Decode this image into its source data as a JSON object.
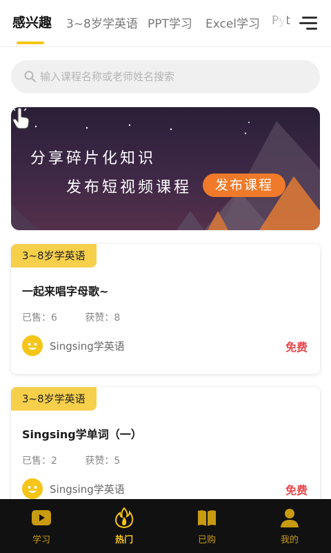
{
  "tabs": [
    {
      "label": "感兴趣",
      "active": true
    },
    {
      "label": "3~8岁学英语"
    },
    {
      "label": "PPT学习"
    },
    {
      "label": "Excel学习"
    },
    {
      "label": "Pyt"
    }
  ],
  "search": {
    "placeholder": "输入课程名称或老师姓名搜索"
  },
  "banner": {
    "line1": "分享碎片化知识",
    "line2": "发布短视频课程",
    "button": "发布课程"
  },
  "courses": [
    {
      "tag": "3~8岁学英语",
      "title": "一起来唱字母歌~",
      "sold_label": "已售：6",
      "likes_label": "获赞：8",
      "author": "Singsing学英语",
      "price": "免费"
    },
    {
      "tag": "3~8岁学英语",
      "title": "Singsing学单词（一）",
      "sold_label": "已售：2",
      "likes_label": "获赞：5",
      "author": "Singsing学英语",
      "price": "免费"
    }
  ],
  "bottom_nav": [
    {
      "label": "学习",
      "icon": "play-icon"
    },
    {
      "label": "热门",
      "icon": "flame-icon",
      "active": true
    },
    {
      "label": "已购",
      "icon": "book-icon"
    },
    {
      "label": "我的",
      "icon": "user-icon"
    }
  ],
  "colors": {
    "accent": "#f5c518",
    "price": "#e8474a",
    "banner_button": "#f07a2a"
  }
}
